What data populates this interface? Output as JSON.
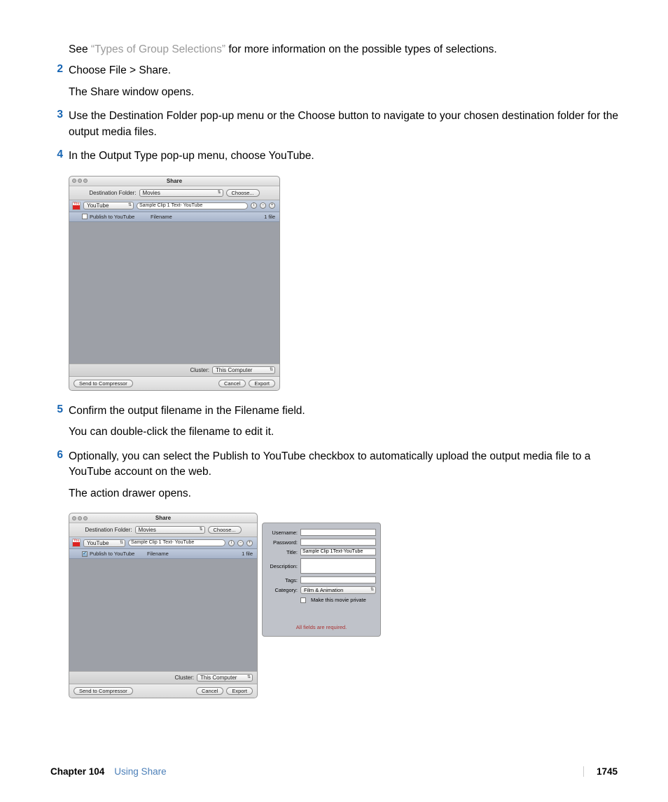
{
  "intro": {
    "see": "See ",
    "link": "“Types of Group Selections”",
    "rest": " for more information on the possible types of selections."
  },
  "steps": {
    "2": {
      "a": "Choose File > Share.",
      "b": "The Share window opens."
    },
    "3": {
      "a": "Use the Destination Folder pop-up menu or the Choose button to navigate to your chosen destination folder for the output media files."
    },
    "4": {
      "a": "In the Output Type pop-up menu, choose YouTube."
    },
    "5": {
      "a": "Confirm the output filename in the Filename field.",
      "b": "You can double-click the filename to edit it."
    },
    "6": {
      "a": "Optionally, you can select the Publish to YouTube checkbox to automatically upload the output media file to a YouTube account on the web.",
      "b": "The action drawer opens."
    }
  },
  "win": {
    "title": "Share",
    "destLabel": "Destination Folder:",
    "destValue": "Movies",
    "chooseBtn": "Choose...",
    "outputType": "YouTube",
    "fname1": "Sample Clip 1",
    "fname2": "Text-",
    "fname3": "YouTube",
    "publishLabel": "Publish to YouTube",
    "filenameHdr": "Filename",
    "countHdr": "1 file",
    "clusterLabel": "Cluster:",
    "clusterValue": "This Computer",
    "sendBtn": "Send to Compressor",
    "cancelBtn": "Cancel",
    "exportBtn": "Export"
  },
  "drawer": {
    "username": "Username:",
    "password": "Password:",
    "titleLbl": "Title:",
    "titleVal": "Sample Clip 1Text-YouTube",
    "desc": "Description:",
    "tags": "Tags:",
    "category": "Category:",
    "categoryVal": "Film & Animation",
    "privateLbl": "Make this movie private",
    "required": "All fields are required."
  },
  "footer": {
    "chapter": "Chapter 104",
    "title": "Using Share",
    "page": "1745"
  }
}
